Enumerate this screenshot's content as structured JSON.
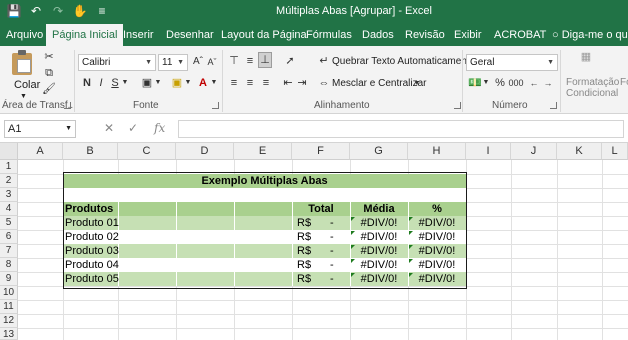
{
  "window": {
    "title": "Múltiplas Abas  [Agrupar]  -  Excel"
  },
  "tabs": [
    {
      "label": "Arquivo"
    },
    {
      "label": "Página Inicial"
    },
    {
      "label": "Inserir"
    },
    {
      "label": "Desenhar"
    },
    {
      "label": "Layout da Página"
    },
    {
      "label": "Fórmulas"
    },
    {
      "label": "Dados"
    },
    {
      "label": "Revisão"
    },
    {
      "label": "Exibir"
    },
    {
      "label": "ACROBAT"
    },
    {
      "label": "Diga-me o que v"
    }
  ],
  "ribbon": {
    "clipboard": {
      "paste_label": "Colar",
      "group_label": "Área de Transf..."
    },
    "font": {
      "name": "Calibri",
      "size": "11",
      "group_label": "Fonte",
      "bold": "N",
      "italic": "I",
      "underline": "S"
    },
    "alignment": {
      "wrap_label": "Quebrar Texto Automaticamente",
      "merge_label": "Mesclar e Centralizar",
      "group_label": "Alinhamento"
    },
    "number": {
      "format": "Geral",
      "group_label": "Número",
      "percent": "%",
      "thousands": "000"
    },
    "styles": {
      "cond_format_line1": "Formatação",
      "cond_format_line2": "Condicional",
      "next": "Fo"
    }
  },
  "formula_bar": {
    "name_box": "A1",
    "fx": "fx",
    "value": ""
  },
  "columns": [
    "A",
    "B",
    "C",
    "D",
    "E",
    "F",
    "G",
    "H",
    "I",
    "J",
    "K",
    "L"
  ],
  "rows": [
    "1",
    "2",
    "3",
    "4",
    "5",
    "6",
    "7",
    "8",
    "9",
    "10",
    "11",
    "12",
    "13"
  ],
  "sheet": {
    "table_title": "Exemplo Múltiplas Abas",
    "headers": {
      "product": "Produtos",
      "total": "Total",
      "average": "Média",
      "percent": "%"
    },
    "items": [
      {
        "product": "Produto 01",
        "currency": "R$",
        "total": "-",
        "average": "#DIV/0!",
        "percent": "#DIV/0!"
      },
      {
        "product": "Produto 02",
        "currency": "R$",
        "total": "-",
        "average": "#DIV/0!",
        "percent": "#DIV/0!"
      },
      {
        "product": "Produto 03",
        "currency": "R$",
        "total": "-",
        "average": "#DIV/0!",
        "percent": "#DIV/0!"
      },
      {
        "product": "Produto 04",
        "currency": "R$",
        "total": "-",
        "average": "#DIV/0!",
        "percent": "#DIV/0!"
      },
      {
        "product": "Produto 05",
        "currency": "R$",
        "total": "-",
        "average": "#DIV/0!",
        "percent": "#DIV/0!"
      }
    ]
  },
  "colors": {
    "excel_green": "#217346",
    "band_dark": "#a9d08e",
    "band_light": "#c6e0b4",
    "band_white": "#ffffff",
    "error_triangle": "#1e7b1e"
  }
}
